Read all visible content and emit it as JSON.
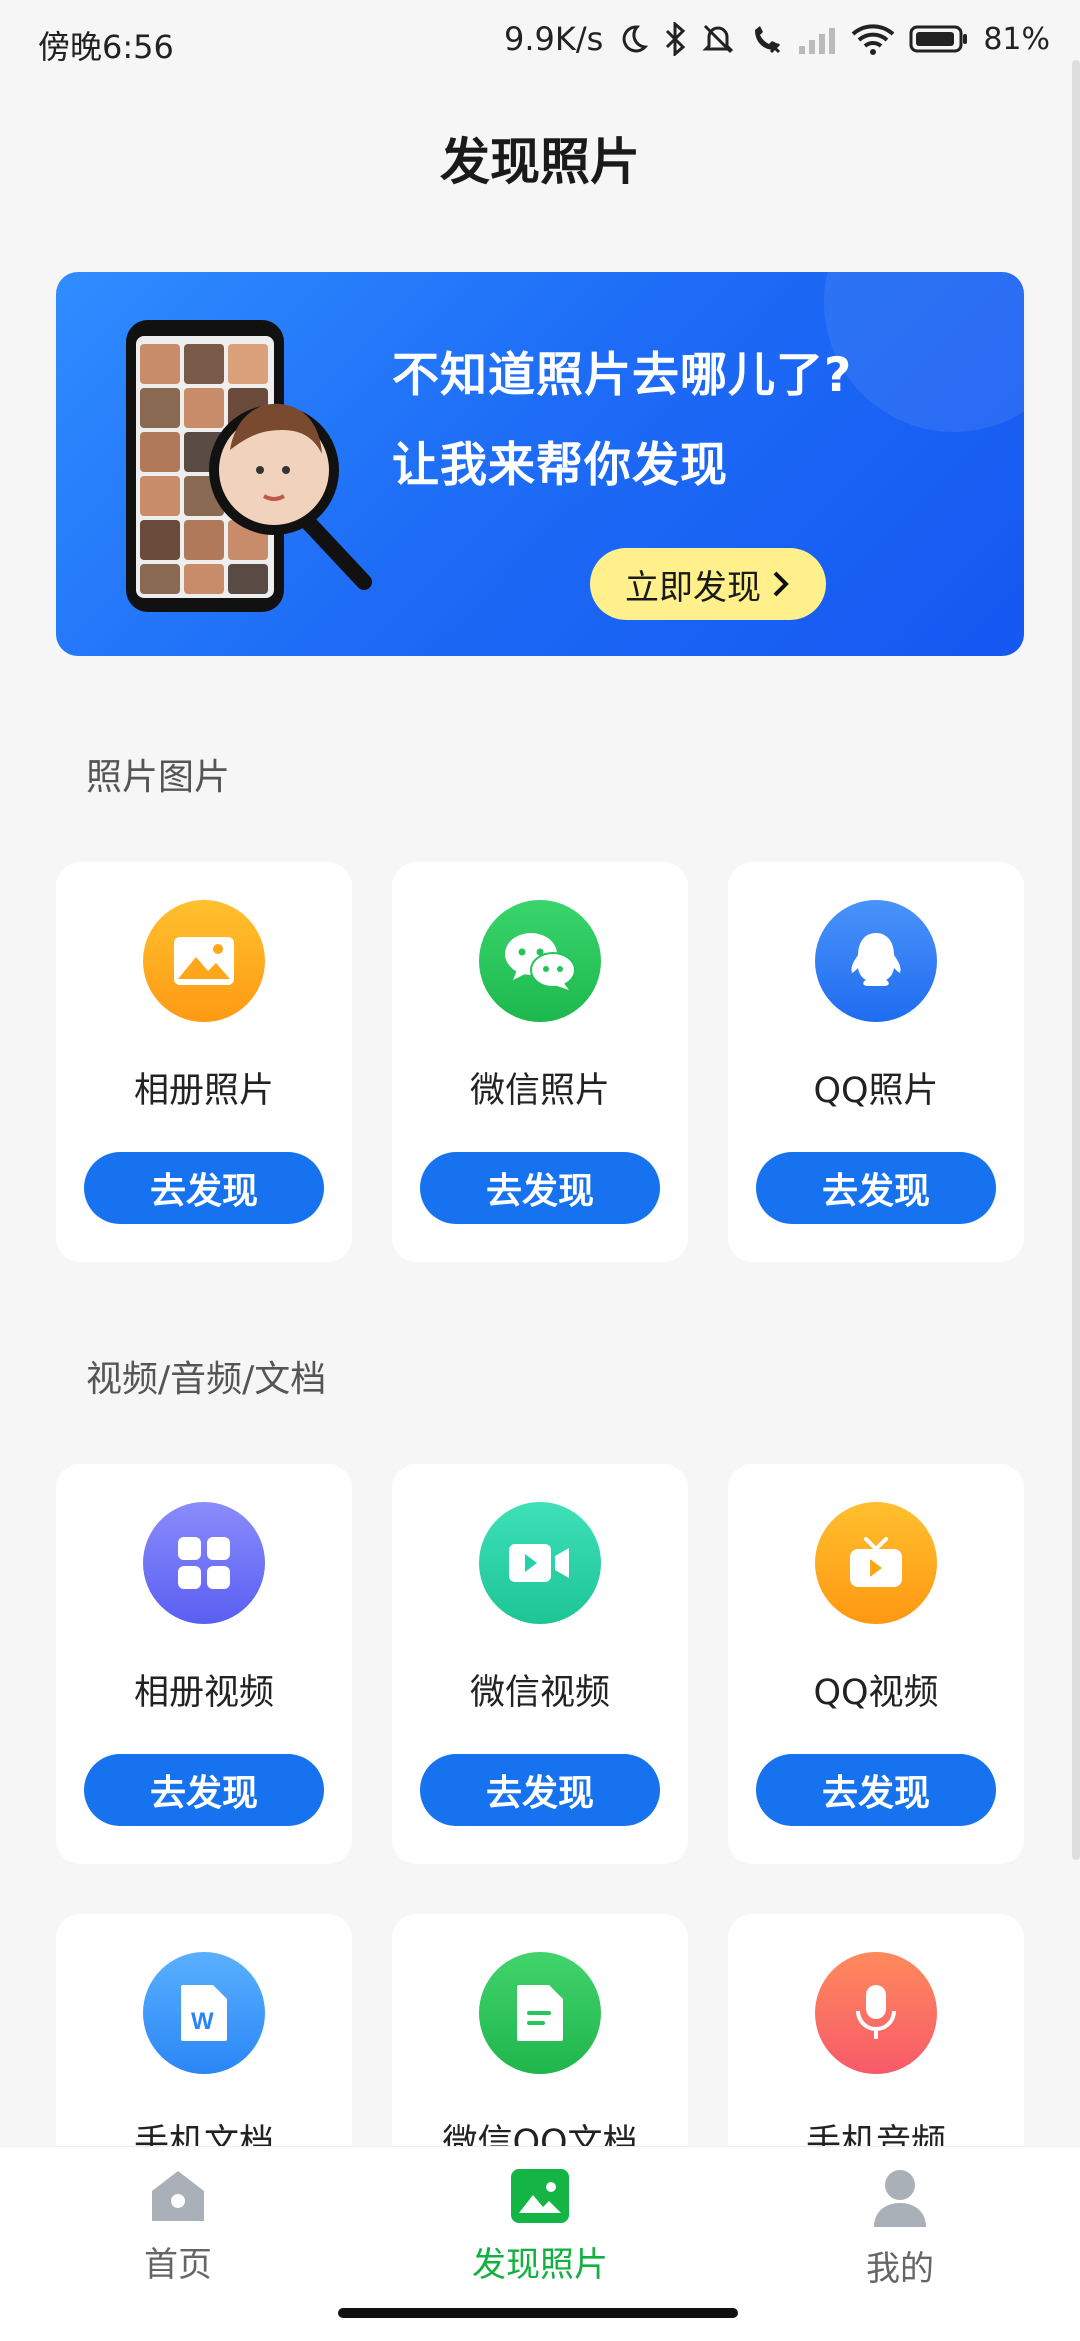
{
  "status_bar": {
    "time": "傍晚6:56",
    "net_speed": "9.9K/s",
    "battery": "81%"
  },
  "page_title": "发现照片",
  "banner": {
    "line1": "不知道照片去哪儿了?",
    "line2": "让我来帮你发现",
    "button": "立即发现"
  },
  "sections": {
    "photos": {
      "title": "照片图片"
    },
    "media": {
      "title": "视频/音频/文档"
    }
  },
  "cards": {
    "album_photos": {
      "label": "相册照片",
      "button": "去发现",
      "icon": "image-icon",
      "color": "#ffa61a"
    },
    "wechat_photos": {
      "label": "微信照片",
      "button": "去发现",
      "icon": "wechat-icon",
      "color": "#22c45a"
    },
    "qq_photos": {
      "label": "QQ照片",
      "button": "去发现",
      "icon": "qq-icon",
      "color": "#2f7cf6"
    },
    "album_videos": {
      "label": "相册视频",
      "button": "去发现",
      "icon": "grid-icon",
      "color": "#6f72f6"
    },
    "wechat_videos": {
      "label": "微信视频",
      "button": "去发现",
      "icon": "video-camera-icon",
      "color": "#26cfa6"
    },
    "qq_videos": {
      "label": "QQ视频",
      "button": "去发现",
      "icon": "tv-icon",
      "color": "#ffa61a"
    },
    "phone_docs": {
      "label": "手机文档",
      "icon": "word-doc-icon",
      "color": "#3a9af9"
    },
    "wechat_qq_docs": {
      "label": "微信QQ文档",
      "icon": "document-icon",
      "color": "#28c45c"
    },
    "phone_audio": {
      "label": "手机音频",
      "icon": "microphone-icon",
      "color": "#fa6d63"
    }
  },
  "bottom_nav": {
    "home": "首页",
    "discover": "发现照片",
    "mine": "我的",
    "active": "discover",
    "active_color": "#12b03f"
  }
}
